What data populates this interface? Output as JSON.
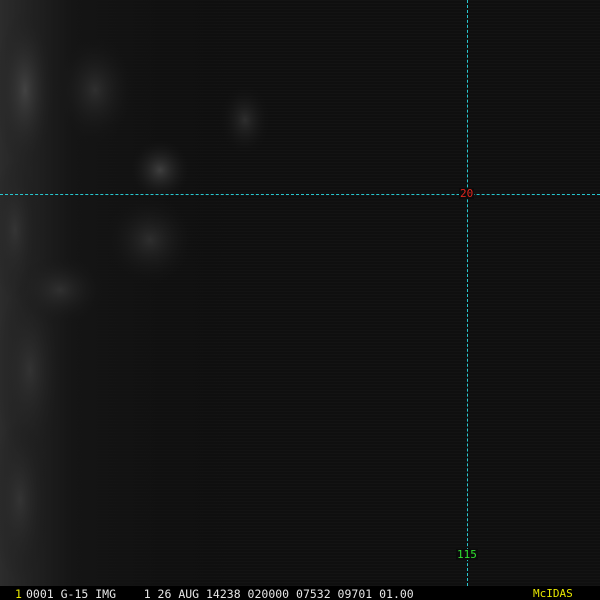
{
  "image": {
    "background_color": "#0f0f0f",
    "cloud_tint": "#3a3a3a"
  },
  "grid": {
    "line_color": "#27c7cf",
    "latitude_label": "20",
    "latitude_label_color": "#e0261e",
    "longitude_label": "115",
    "longitude_label_color": "#2fe02f"
  },
  "status_bar": {
    "frame_number": "1",
    "frame_number_color": "#e8e800",
    "text": "0001 G-15 IMG    1 26 AUG 14238 020000 07532 09701 01.00",
    "brand": "McIDAS",
    "brand_color": "#e8e800"
  }
}
